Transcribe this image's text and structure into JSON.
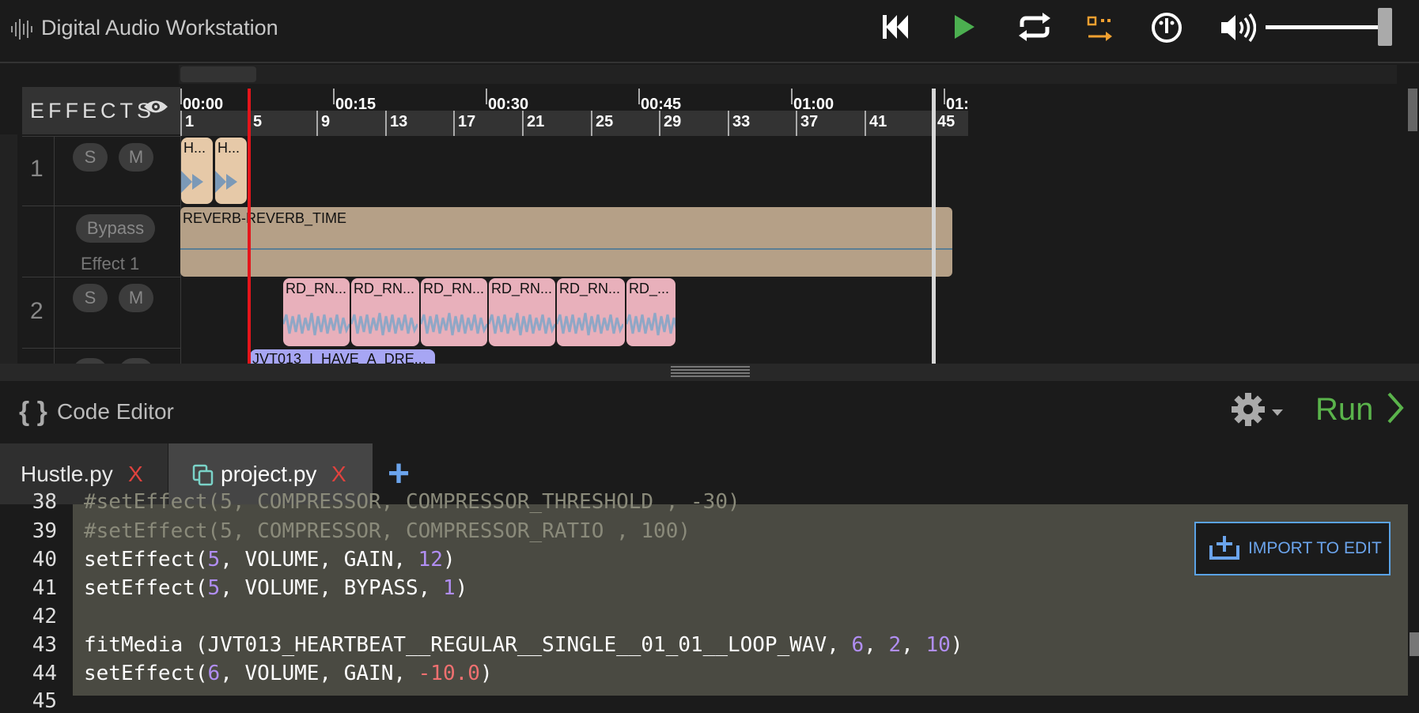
{
  "app": {
    "title": "Digital Audio Workstation"
  },
  "transport": {
    "icons": [
      "skip-back-icon",
      "play-icon",
      "loop-icon",
      "follow-playhead-icon",
      "metronome-icon",
      "volume-icon"
    ],
    "colors": {
      "play": "#4caf50",
      "follow": "#f0a030",
      "icons": "#ffffff"
    },
    "volume_level": 0.85
  },
  "timeline": {
    "effects_label": "EFFECTS",
    "time_labels": [
      "00:00",
      "00:15",
      "00:30",
      "00:45",
      "01:00",
      "01:"
    ],
    "bar_labels": [
      "1",
      "5",
      "9",
      "13",
      "17",
      "21",
      "25",
      "29",
      "33",
      "37",
      "41",
      "45"
    ]
  },
  "tracks": [
    {
      "number": "1",
      "solo": "S",
      "mute": "M",
      "clips": [
        "H...",
        "H..."
      ],
      "effect": {
        "bypass": "Bypass",
        "name": "Effect 1",
        "envelope_label": "REVERB-REVERB_TIME"
      }
    },
    {
      "number": "2",
      "solo": "S",
      "mute": "M",
      "clips": [
        "RD_RN...",
        "RD_RN...",
        "RD_RN...",
        "RD_RN...",
        "RD_RN...",
        "RD_..."
      ]
    },
    {
      "clips": [
        "JVT013_I_HAVE_A_DRE..."
      ]
    }
  ],
  "code_editor": {
    "title": "Code Editor",
    "icon": "{ }",
    "run_label": "Run",
    "tabs": [
      {
        "label": "Hustle.py",
        "close": "X"
      },
      {
        "label": "project.py",
        "close": "X"
      }
    ],
    "add_tab": "+",
    "import_label": "IMPORT TO EDIT",
    "lines": [
      {
        "num": "38",
        "text": "#setEffect(5, COMPRESSOR, COMPRESSOR_THRESHOLD , -30)"
      },
      {
        "num": "39",
        "text": "#setEffect(5, COMPRESSOR, COMPRESSOR_RATIO , 100)"
      },
      {
        "num": "40",
        "text_a": "setEffect(",
        "n1": "5",
        "text_b": ", VOLUME, GAIN, ",
        "n2": "12",
        "text_c": ")"
      },
      {
        "num": "41",
        "text_a": "setEffect(",
        "n1": "5",
        "text_b": ", VOLUME, BYPASS, ",
        "n2": "1",
        "text_c": ")"
      },
      {
        "num": "42",
        "text": ""
      },
      {
        "num": "43",
        "text_a": "fitMedia (JVT013_HEARTBEAT__REGULAR__SINGLE__01_01__LOOP_WAV, ",
        "n1": "6",
        "sep1": ", ",
        "n2": "2",
        "sep2": ", ",
        "n3": "10",
        "text_c": ")"
      },
      {
        "num": "44",
        "text_a": "setEffect(",
        "n1": "6",
        "text_b": ", VOLUME, GAIN, ",
        "n2": "-10.0",
        "text_c": ")"
      },
      {
        "num": "45",
        "text": ""
      }
    ]
  }
}
